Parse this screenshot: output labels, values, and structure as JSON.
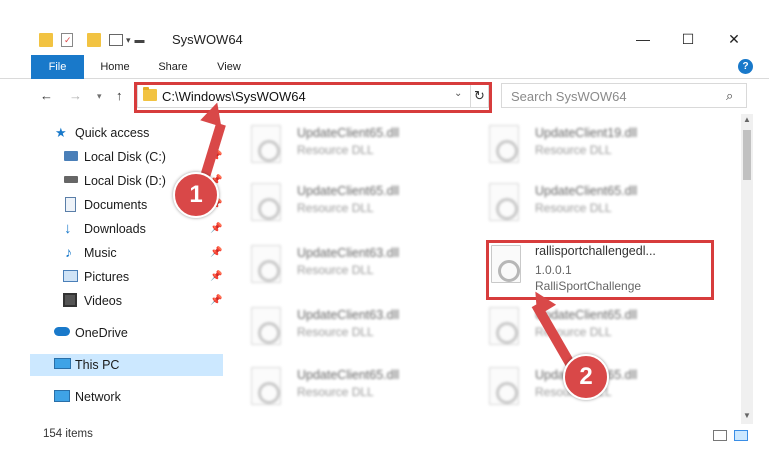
{
  "window": {
    "title": "SysWOW64",
    "minimize_glyph": "—",
    "maximize_glyph": "☐",
    "close_glyph": "✕"
  },
  "ribbon": {
    "tabs": [
      "File",
      "Home",
      "Share",
      "View"
    ],
    "help_label": "?"
  },
  "nav": {
    "address": "C:\\Windows\\SysWOW64",
    "search_placeholder": "Search SysWOW64",
    "icons": {
      "back": "back-arrow-icon",
      "forward": "forward-arrow-icon",
      "recent": "chevron-down-icon",
      "up": "up-arrow-icon",
      "refresh": "refresh-icon",
      "search": "magnifier-icon"
    }
  },
  "sidebar": {
    "items": [
      {
        "label": "Quick access",
        "icon": "star-icon"
      },
      {
        "label": "Local Disk (C:)",
        "icon": "drive-icon",
        "pinned": true
      },
      {
        "label": "Local Disk (D:)",
        "icon": "drive-icon",
        "pinned": true
      },
      {
        "label": "Documents",
        "icon": "documents-icon",
        "pinned": true
      },
      {
        "label": "Downloads",
        "icon": "download-icon",
        "pinned": true
      },
      {
        "label": "Music",
        "icon": "music-icon",
        "pinned": true
      },
      {
        "label": "Pictures",
        "icon": "pictures-icon",
        "pinned": true
      },
      {
        "label": "Videos",
        "icon": "videos-icon",
        "pinned": true
      },
      {
        "label": "OneDrive",
        "icon": "cloud-icon"
      },
      {
        "label": "This PC",
        "icon": "computer-icon",
        "selected": true
      },
      {
        "label": "Network",
        "icon": "network-icon"
      }
    ]
  },
  "files": [
    {
      "name": "UpdateClient65.dll",
      "type": "Resource DLL"
    },
    {
      "name": "UpdateClient19.dll",
      "type": "Resource DLL"
    },
    {
      "name": "UpdateClient65.dll",
      "type": "Resource DLL"
    },
    {
      "name": "UpdateClient65.dll",
      "type": "Resource DLL"
    },
    {
      "name": "UpdateClient63.dll",
      "type": "Resource DLL"
    },
    {
      "name": "rallisportchallengedl...",
      "version": "1.0.0.1",
      "type": "RalliSportChallenge"
    },
    {
      "name": "UpdateClient63.dll",
      "type": "Resource DLL"
    },
    {
      "name": "UpdateClient65.dll",
      "type": "Resource DLL"
    },
    {
      "name": "UpdateClient65.dll",
      "type": "Resource DLL"
    },
    {
      "name": "UpdateClient65.dll",
      "type": "Resource DLL"
    }
  ],
  "status": {
    "item_count": "154 items"
  },
  "callouts": [
    {
      "number": "1"
    },
    {
      "number": "2"
    }
  ],
  "colors": {
    "accent": "#1979ca",
    "highlight": "#d73c3c",
    "selected_bg": "#cce8ff",
    "callout": "#d94848"
  }
}
